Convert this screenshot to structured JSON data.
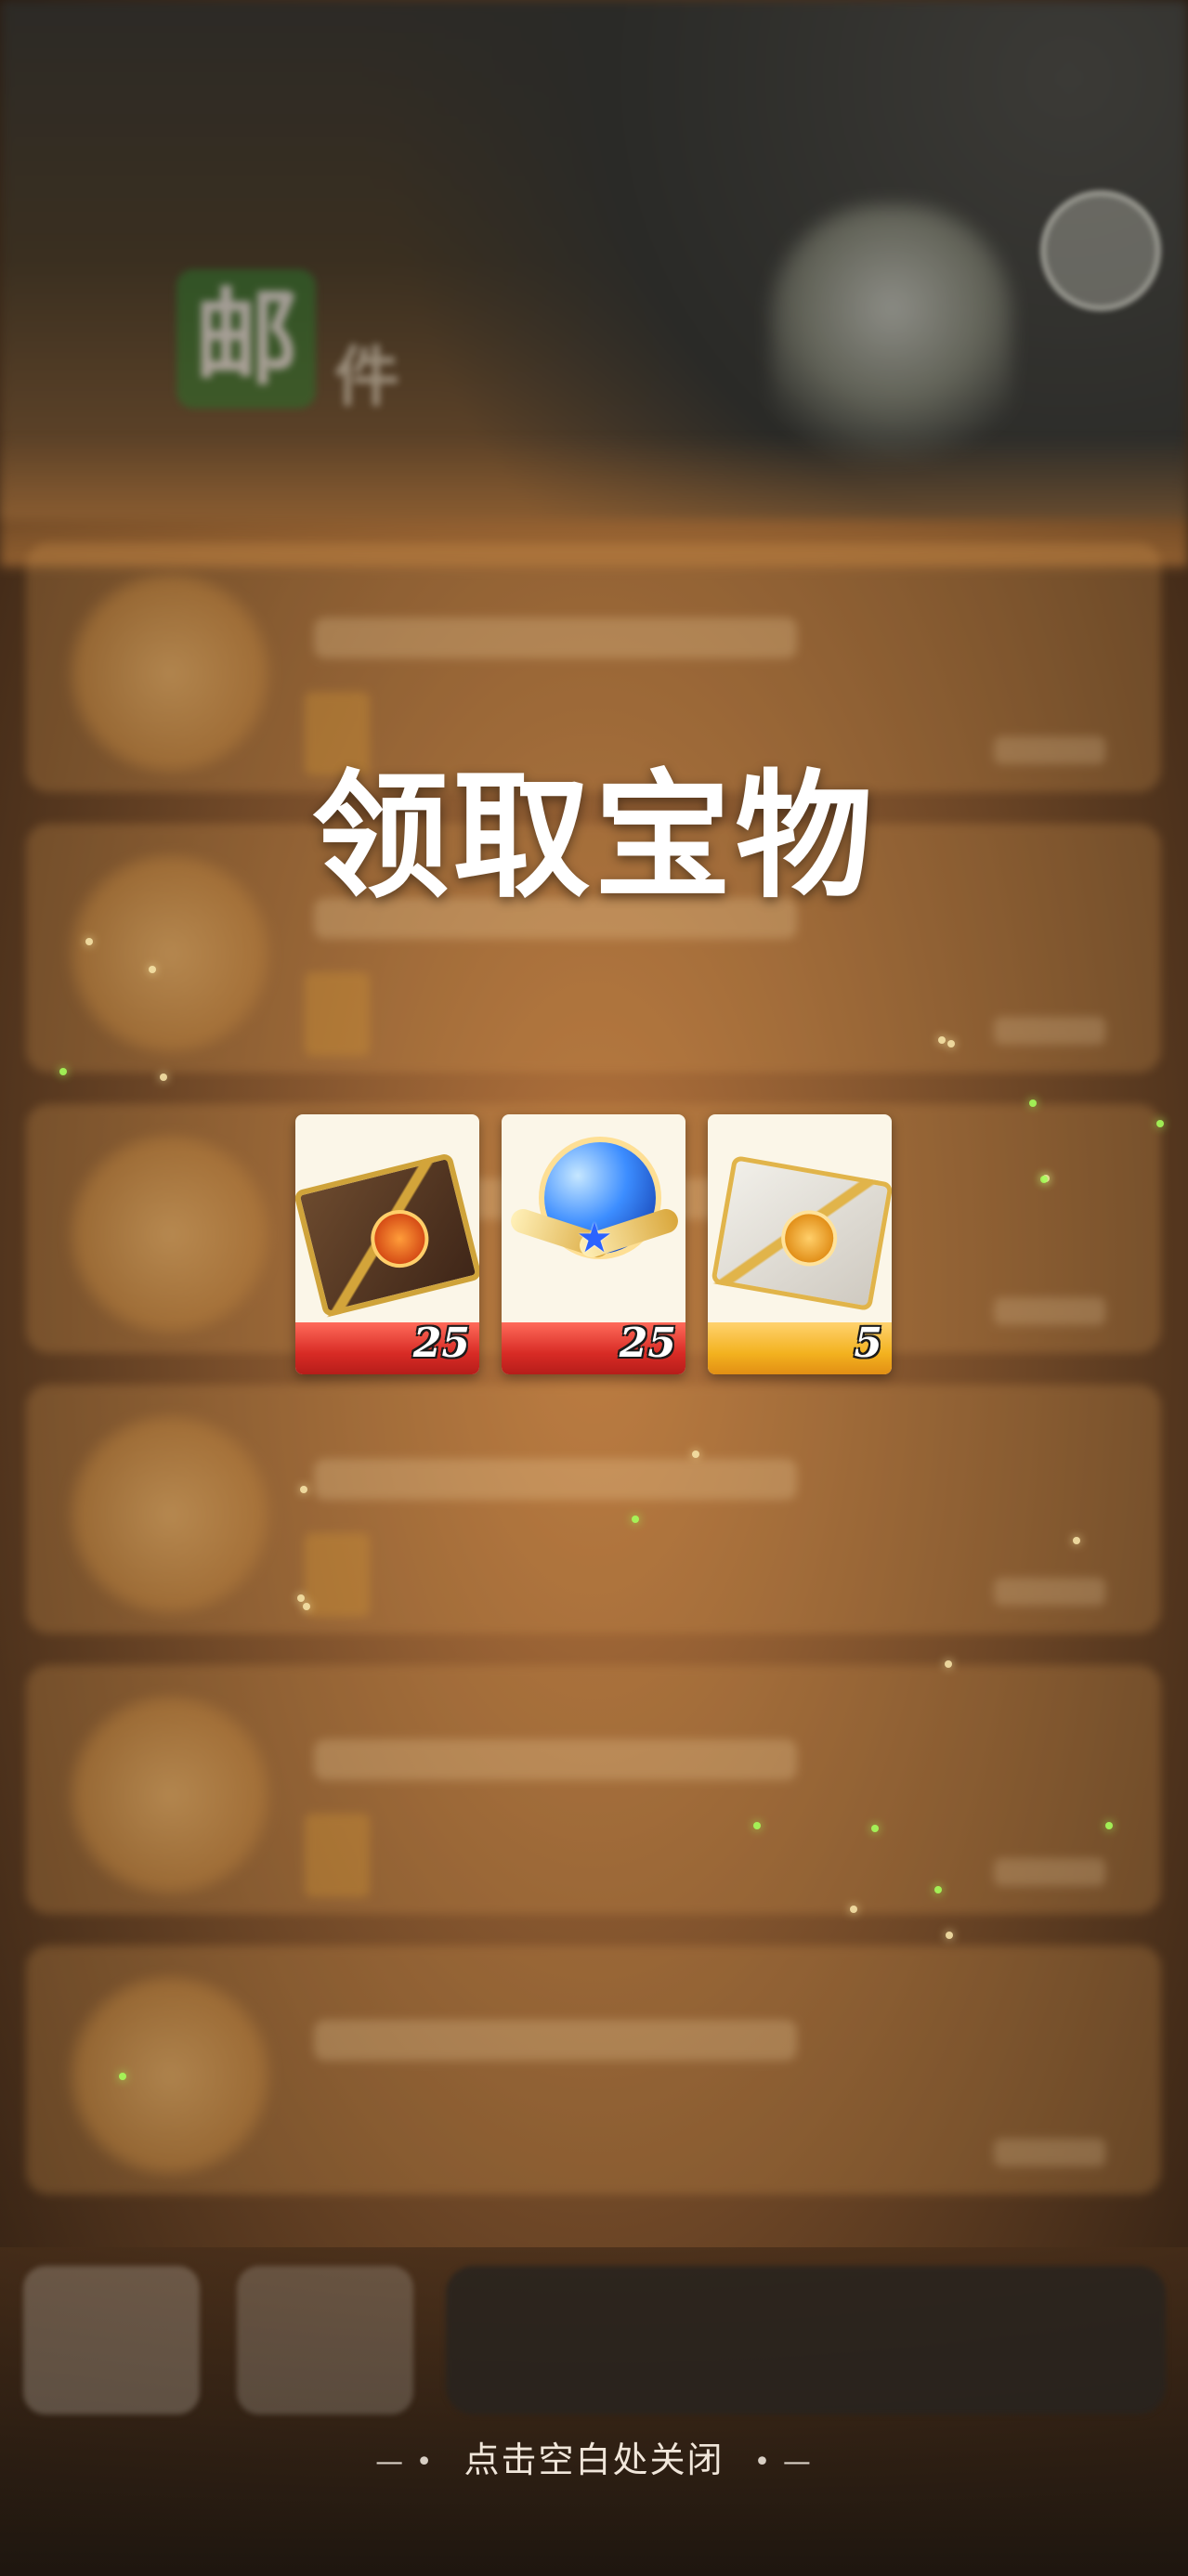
{
  "background": {
    "header_title": {
      "big": "邮",
      "small": "件"
    }
  },
  "popup": {
    "title": "领取宝物",
    "rewards": [
      {
        "name": "brown-envelope",
        "count": "25"
      },
      {
        "name": "blue-orb-emblem",
        "count": "25"
      },
      {
        "name": "white-envelope",
        "count": "5"
      }
    ],
    "close_hint": "点击空白处关闭",
    "close_hint_left_decor": "— •",
    "close_hint_right_decor": "• —"
  },
  "colors": {
    "accent_red": "#d82b25",
    "accent_gold": "#f3b21f",
    "title_white": "#ffffff"
  }
}
